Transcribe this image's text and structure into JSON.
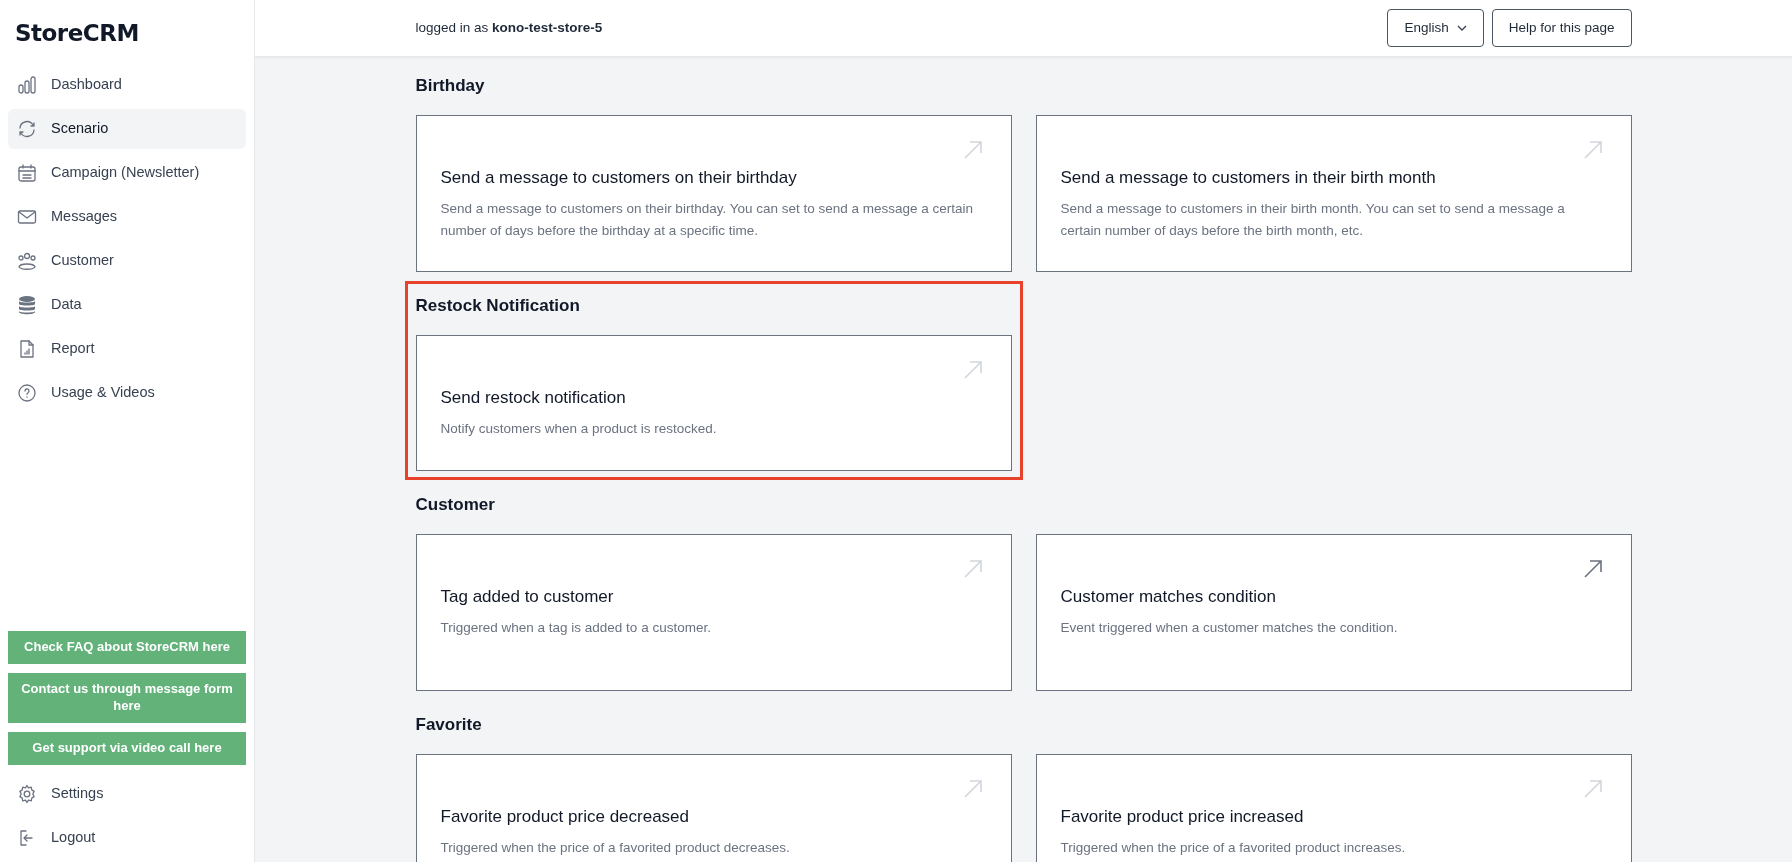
{
  "sidebar": {
    "logo": "StoreCRM",
    "items": [
      {
        "label": "Dashboard",
        "selected": false
      },
      {
        "label": "Scenario",
        "selected": true
      },
      {
        "label": "Campaign (Newsletter)",
        "selected": false
      },
      {
        "label": "Messages",
        "selected": false
      },
      {
        "label": "Customer",
        "selected": false
      },
      {
        "label": "Data",
        "selected": false
      },
      {
        "label": "Report",
        "selected": false
      },
      {
        "label": "Usage & Videos",
        "selected": false
      }
    ],
    "support_buttons": [
      "Check FAQ about StoreCRM here",
      "Contact us through message form here",
      "Get support via video call here"
    ],
    "bottom_items": [
      {
        "label": "Settings"
      },
      {
        "label": "Logout"
      }
    ]
  },
  "header": {
    "login_text": "logged in as **kono-test-store-5**",
    "language": "English",
    "help_button": "Help for this page"
  },
  "sections": [
    {
      "title": "Birthday",
      "highlighted": false,
      "cards": [
        {
          "title": "Send a message to customers on their birthday",
          "description": "Send a message to customers on their birthday. You can set to send a message a certain number of days before the birthday at a specific time.",
          "hovered": false
        },
        {
          "title": "Send a message to customers in their birth month",
          "description": "Send a message to customers in their birth month. You can set to send a message a certain number of days before the birth month, etc.",
          "hovered": false
        }
      ]
    },
    {
      "title": "Restock Notification",
      "highlighted": true,
      "cards": [
        {
          "title": "Send restock notification",
          "description": "Notify customers when a product is restocked.",
          "hovered": false
        }
      ]
    },
    {
      "title": "Customer",
      "highlighted": false,
      "cards": [
        {
          "title": "Tag added to customer",
          "description": "Triggered when a tag is added to a customer.",
          "hovered": false
        },
        {
          "title": "Customer matches condition",
          "description": "Event triggered when a customer matches the condition.",
          "hovered": true
        }
      ]
    },
    {
      "title": "Favorite",
      "highlighted": false,
      "cards": [
        {
          "title": "Favorite product price decreased",
          "description": "Triggered when the price of a favorited product decreases.",
          "hovered": false
        },
        {
          "title": "Favorite product price increased",
          "description": "Triggered when the price of a favorited product increases.",
          "hovered": false
        }
      ]
    }
  ]
}
